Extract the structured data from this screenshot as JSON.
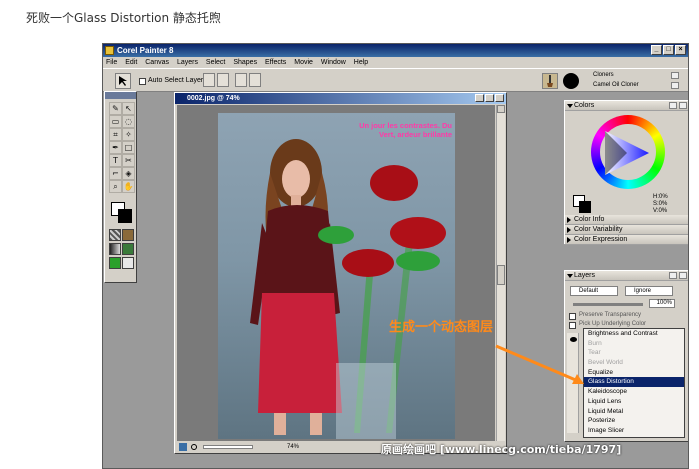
{
  "heading": "死败一个Glass Distortion 静态托煦",
  "app": {
    "title": "Corel Painter 8",
    "menu": [
      "File",
      "Edit",
      "Canvas",
      "Layers",
      "Select",
      "Shapes",
      "Effects",
      "Movie",
      "Window",
      "Help"
    ],
    "property_bar": {
      "auto_select_label": "Auto Select Layer"
    },
    "brush_selector": {
      "category": "Cloners",
      "variant": "Camel Oil Cloner"
    }
  },
  "document": {
    "title": "0002.jpg @ 74%",
    "zoom": "74%",
    "magazine_text": [
      "Un jour les contrastes. Du",
      "Vert, ardeur brillante"
    ]
  },
  "colors_panel": {
    "title": "Colors",
    "readout": [
      "H:0%",
      "S:0%",
      "V:0%"
    ],
    "collapsed_sections": [
      "Color Info",
      "Color Variability",
      "Color Expression"
    ]
  },
  "layers_panel": {
    "title": "Layers",
    "composite_method": "Default",
    "depth_method": "Ignore",
    "opacity": "100%",
    "preserve_transparency": "Preserve Transparency",
    "pick_up_underlying": "Pick Up Underlying Color"
  },
  "dynamic_plugins_menu": {
    "items": [
      {
        "label": "Brightness and Contrast",
        "state": "normal"
      },
      {
        "label": "Burn",
        "state": "disabled"
      },
      {
        "label": "Tear",
        "state": "disabled"
      },
      {
        "label": "Bevel World",
        "state": "disabled"
      },
      {
        "label": "Equalize",
        "state": "normal"
      },
      {
        "label": "Glass Distortion",
        "state": "selected"
      },
      {
        "label": "Kaleidoscope",
        "state": "normal"
      },
      {
        "label": "Liquid Lens",
        "state": "normal"
      },
      {
        "label": "Liquid Metal",
        "state": "normal"
      },
      {
        "label": "Posterize",
        "state": "normal"
      },
      {
        "label": "Image Slicer",
        "state": "normal"
      }
    ]
  },
  "annotation": "生成一个动态图层",
  "watermark": "原画绘画吧 [www.linecg.com/tieba/1797]",
  "colors": {
    "accent": "#ff8a1a",
    "selection": "#0a246a",
    "titlebar": "#0a246a",
    "chrome": "#d4d0c8"
  }
}
